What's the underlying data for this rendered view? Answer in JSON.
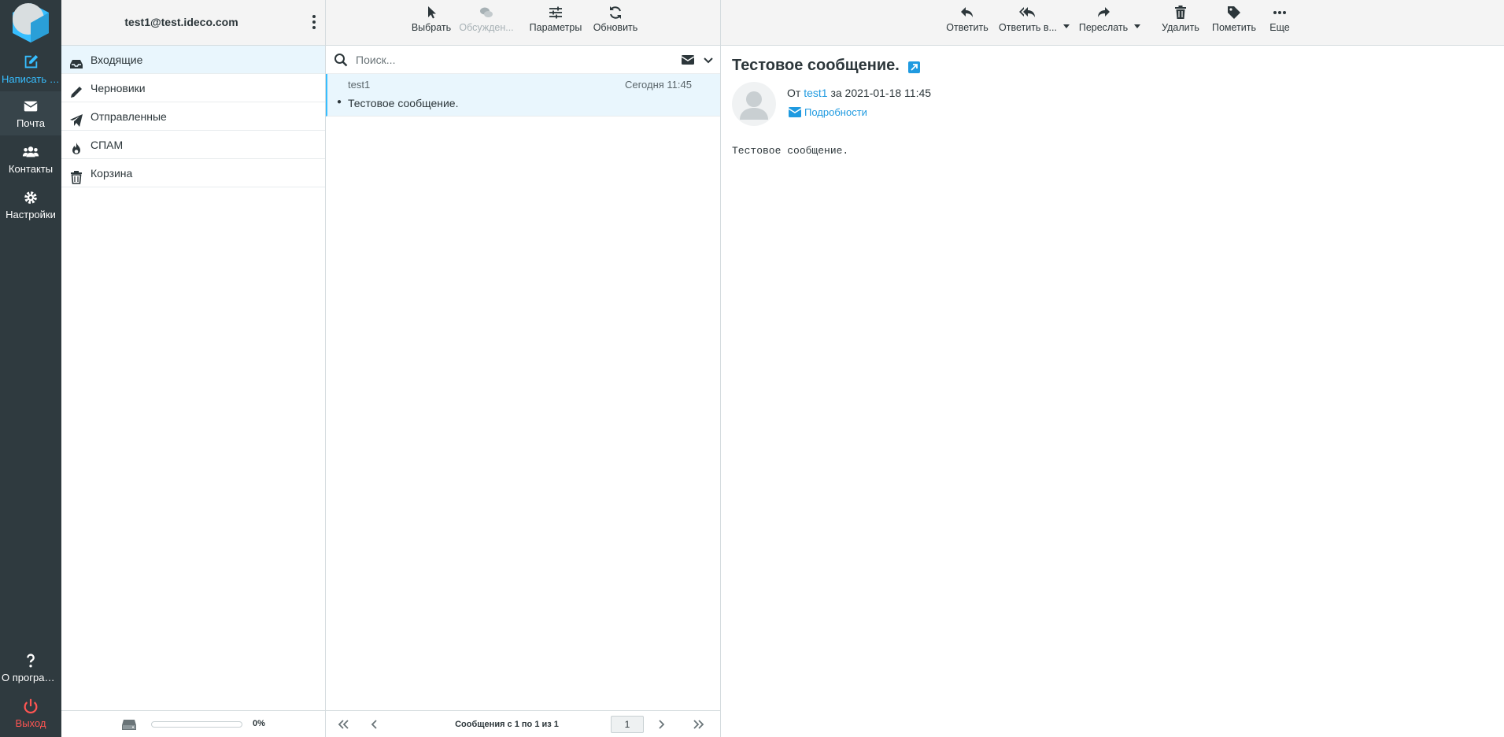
{
  "navbar": {
    "compose": "Написать с...",
    "mail": "Почта",
    "contacts": "Контакты",
    "settings": "Настройки",
    "about": "О програм...",
    "logout": "Выход"
  },
  "folders": {
    "account": "test1@test.ideco.com",
    "items": [
      {
        "label": "Входящие",
        "icon": "inbox-icon"
      },
      {
        "label": "Черновики",
        "icon": "pencil-icon"
      },
      {
        "label": "Отправленные",
        "icon": "paper-plane-icon"
      },
      {
        "label": "СПАМ",
        "icon": "fire-icon"
      },
      {
        "label": "Корзина",
        "icon": "trash-icon"
      }
    ],
    "quota_text": "0%",
    "quota_fraction": 0
  },
  "list_toolbar": {
    "select": "Выбрать",
    "threads": "Обсужден...",
    "options": "Параметры",
    "refresh": "Обновить"
  },
  "search": {
    "placeholder": "Поиск..."
  },
  "messages": [
    {
      "from": "test1",
      "date": "Сегодня 11:45",
      "subject": "Тестовое сообщение."
    }
  ],
  "pagination": {
    "info": "Сообщения с 1 по 1 из 1",
    "page": "1"
  },
  "preview_toolbar": {
    "reply": "Ответить",
    "reply_all": "Ответить в...",
    "forward": "Переслать",
    "delete": "Удалить",
    "mark": "Пометить",
    "more": "Еще"
  },
  "message": {
    "title": "Тестовое сообщение.",
    "from_prefix": "От",
    "from_name": "test1",
    "date_text": "за 2021-01-18 11:45",
    "details": "Подробности",
    "body": "Тестовое сообщение."
  },
  "colors": {
    "accent": "#37beff",
    "link": "#1f9ae0",
    "sidebar": "#2f3a3f",
    "logout": "#ff5552",
    "selected_row": "#e9f6fd"
  }
}
